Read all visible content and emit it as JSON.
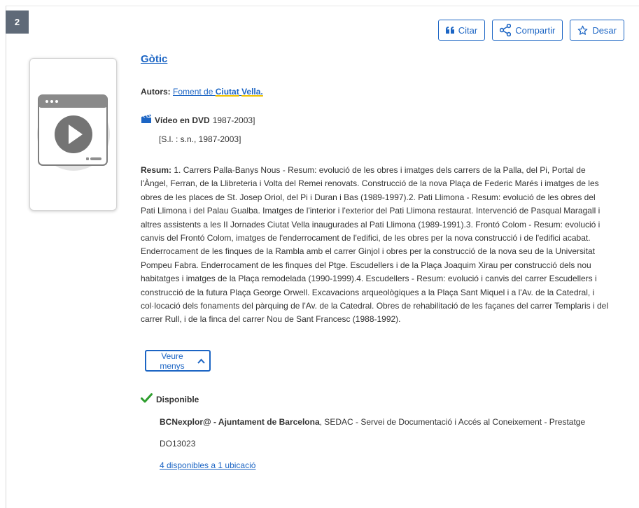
{
  "result": {
    "number": "2",
    "title": "Gòtic",
    "authors_label": "Autors:",
    "author_prefix": "Foment de ",
    "author_hl1": "Ciutat",
    "author_hl2": "Vella.",
    "format_type": "Vídeo en DVD",
    "format_years": "1987-2003]",
    "publication": "[S.l. : s.n., 1987-2003]",
    "summary_label": "Resum:",
    "summary_text": "1. Carrers Palla-Banys Nous - Resum: evolució de les obres i imatges dels carrers de la Palla, del Pi, Portal de l'Àngel, Ferran, de la Llibreteria i Volta del Remei renovats. Construcció de la nova Plaça de Federic Marés i imatges de les obres de les places de St. Josep Oriol, del Pi i Duran i Bas (1989-1997).2. Pati Llimona - Resum: evolució de les obres del Pati Llimona i del Palau Gualba. Imatges de l'interior i l'exterior del Pati Llimona restaurat. Intervenció de Pasqual Maragall i altres assistents a les II Jornades Ciutat Vella inaugurades al Pati Llimona (1989-1991).3. Frontó Colom - Resum: evolució i canvis del Frontó Colom, imatges de l'enderrocament de l'edifici, de les obres per la nova construcció i de l'edifici acabat. Enderrocament de les finques de la Rambla amb el carrer Ginjol i obres per la construcció de la nova seu de la Universitat Pompeu Fabra. Enderrocament de les finques del Ptge. Escudellers i de la Plaça Joaquim Xirau per construcció dels nou habitatges i imatges de la Plaça remodelada (1990-1999).4. Escudellers - Resum: evolució i canvis del carrer Escudellers i construcció de la futura Plaça George Orwell. Excavacions arqueològiques a la Plaça Sant Miquel i a l'Av. de la Catedral, i col·locació dels fonaments del pàrquing de l'Av. de la Catedral. Obres de rehabilitació de les façanes del carrer Templaris i del carrer Rull, i de la finca del carrer Nou de Sant Francesc (1988-1992).",
    "show_less_label": "Veure menys",
    "availability_status": "Disponible",
    "library_bold": "BCNexplor@ - Ajuntament de Barcelona",
    "library_rest": ", SEDAC - Servei de Documentació i Accés al Coneixement - Prestatge",
    "call_number": "DO13023",
    "availability_link": "4 disponibles a 1 ubicació"
  },
  "actions": {
    "cite_label": "Citar",
    "share_label": "Compartir",
    "save_label": "Desar"
  },
  "colors": {
    "link": "#1c65c4",
    "badge": "#5f6a78",
    "available": "#2e9e2e",
    "highlight_underline": "#f2c300"
  },
  "icons": {
    "cite": "quote-icon",
    "share": "share-icon",
    "save": "star-icon",
    "format": "video-clapper-icon",
    "available": "checkmark-icon",
    "show_less": "chevron-up-icon",
    "thumbnail": "video-play-icon"
  }
}
